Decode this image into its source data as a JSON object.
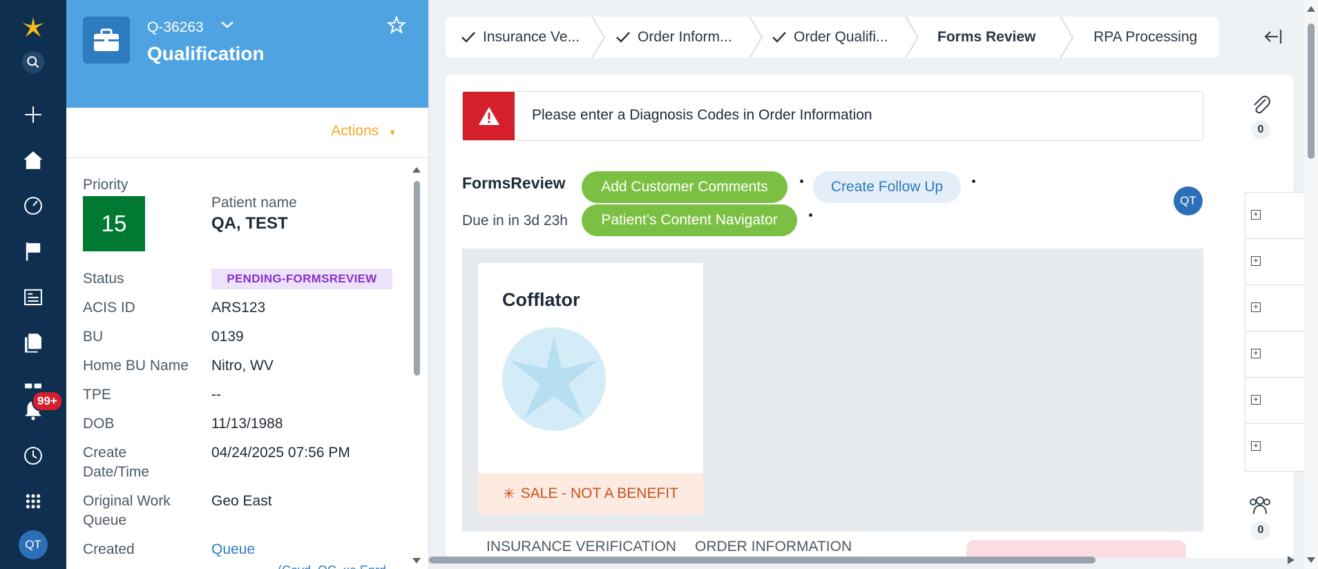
{
  "nav": {
    "notification_count": "99+",
    "user_initials": "QT"
  },
  "case": {
    "id": "Q-36263",
    "title": "Qualification",
    "actions_label": "Actions",
    "priority_label": "Priority",
    "priority_value": "15",
    "patient_name_label": "Patient name",
    "patient_name": "QA, TEST",
    "fields": [
      {
        "label": "Status",
        "value": "PENDING-FORMSREVIEW"
      },
      {
        "label": "ACIS ID",
        "value": "ARS123"
      },
      {
        "label": "BU",
        "value": "0139"
      },
      {
        "label": "Home BU Name",
        "value": "Nitro, WV"
      },
      {
        "label": "TPE",
        "value": "--"
      },
      {
        "label": "DOB",
        "value": "11/13/1988"
      },
      {
        "label": "Create Date/Time",
        "value": "04/24/2025 07:56 PM"
      },
      {
        "label": "Original Work Queue",
        "value": "Geo East"
      },
      {
        "label": "Created",
        "value": "Queue"
      }
    ],
    "cutoff_text": "(Covd_QC_xe Enrd"
  },
  "stages": [
    {
      "label": "Insurance Ve...",
      "done": true
    },
    {
      "label": "Order Inform...",
      "done": true
    },
    {
      "label": "Order Qualifi...",
      "done": true
    },
    {
      "label": "Forms Review",
      "done": false,
      "current": true
    },
    {
      "label": "RPA Processing",
      "done": false
    }
  ],
  "main": {
    "alert_text": "Please enter a Diagnosis Codes in Order Information",
    "section_title": "FormsReview",
    "due_label": "Due in",
    "due_value": "in 3d 23h",
    "btn_add_comments": "Add Customer Comments",
    "btn_follow_up": "Create Follow Up",
    "btn_navigator": "Patient’s Content Navigator",
    "assignee_initials": "QT",
    "product_name": "Cofflator",
    "product_flag": "SALE - NOT A BENEFIT",
    "tab_1": "INSURANCE VERIFICATION",
    "tab_2": "ORDER INFORMATION"
  },
  "utility": {
    "attachments_count": "0",
    "followers_count": "0"
  },
  "colors": {
    "nav_bg": "#0e2f4f",
    "header_blue": "#4fa3e0",
    "priority_green": "#007a33",
    "action_green": "#7cc043",
    "alert_red": "#d61f2c",
    "accent_orange": "#f5a623"
  }
}
